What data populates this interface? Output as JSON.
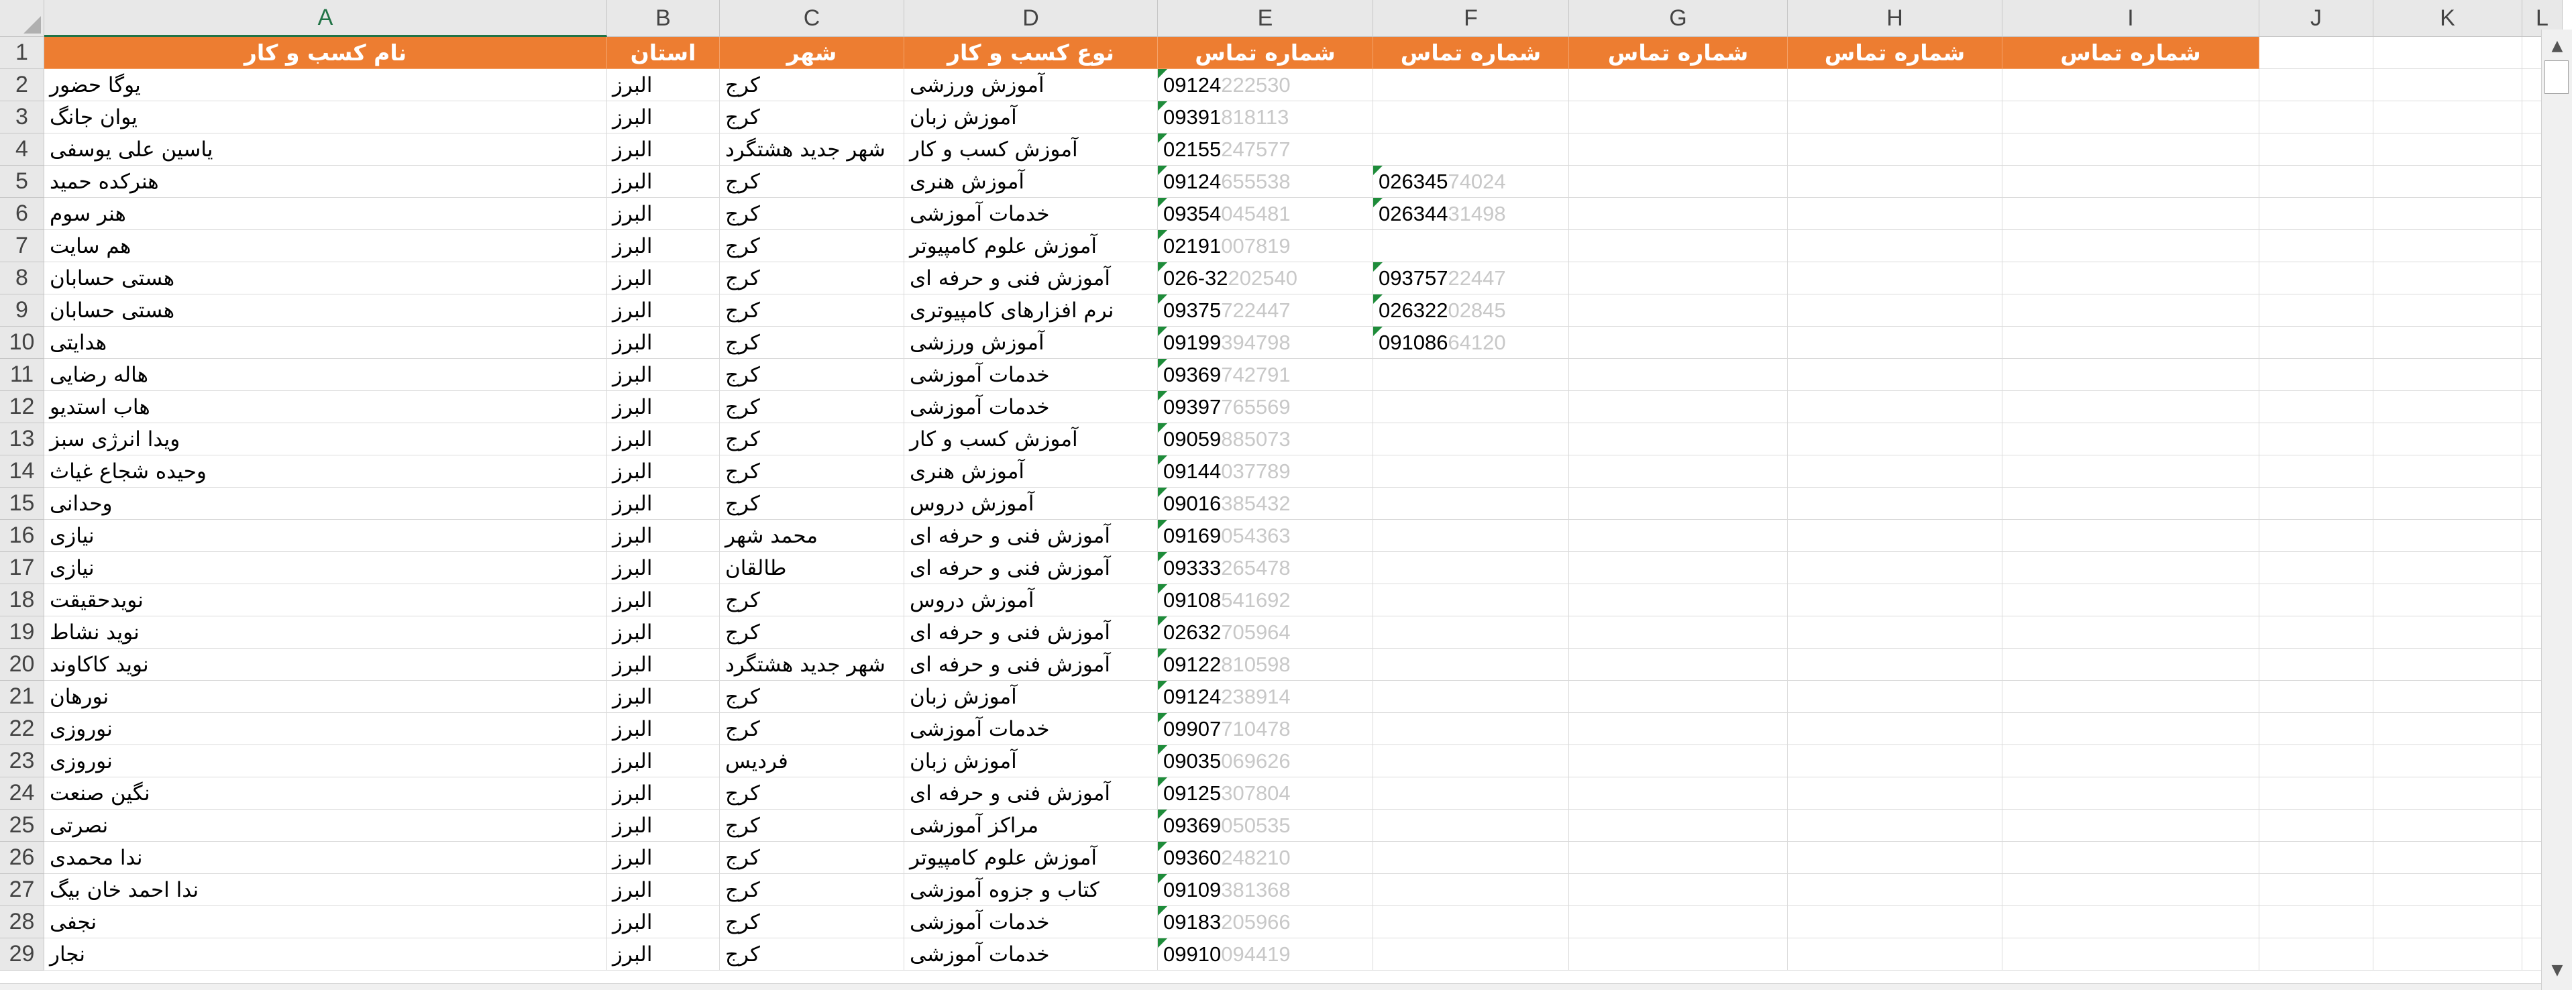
{
  "columns": [
    "A",
    "B",
    "C",
    "D",
    "E",
    "F",
    "G",
    "H",
    "I",
    "J",
    "K",
    "L"
  ],
  "header_row": [
    "نام کسب و کار",
    "استان",
    "شهر",
    "نوع کسب و کار",
    "شماره تماس",
    "شماره تماس",
    "شماره تماس",
    "شماره تماس",
    "شماره تماس"
  ],
  "row_numbers": [
    "1",
    "2",
    "3",
    "4",
    "5",
    "6",
    "7",
    "8",
    "9",
    "10",
    "11",
    "12",
    "13",
    "14",
    "15",
    "16",
    "17",
    "18",
    "19",
    "20",
    "21",
    "22",
    "23",
    "24",
    "25",
    "26",
    "27",
    "28",
    "29"
  ],
  "rows": [
    {
      "name": "یوگا حضور",
      "province": "البرز",
      "city": "کرج",
      "type": "آموزش ورزشی",
      "phone1": "09124",
      "phone1_tail": "222530",
      "phone2": "",
      "phone2_tail": ""
    },
    {
      "name": "یوان جانگ",
      "province": "البرز",
      "city": "کرج",
      "type": "آموزش زبان",
      "phone1": "09391",
      "phone1_tail": "818113",
      "phone2": "",
      "phone2_tail": ""
    },
    {
      "name": "یاسین علی یوسفی",
      "province": "البرز",
      "city": "شهر جدید هشتگرد",
      "type": "آموزش کسب و کار",
      "phone1": "02155",
      "phone1_tail": "247577",
      "phone2": "",
      "phone2_tail": ""
    },
    {
      "name": "هنرکده حمید",
      "province": "البرز",
      "city": "کرج",
      "type": "آموزش هنری",
      "phone1": "09124",
      "phone1_tail": "655538",
      "phone2": "026345",
      "phone2_tail": "74024"
    },
    {
      "name": "هنر سوم",
      "province": "البرز",
      "city": "کرج",
      "type": "خدمات آموزشی",
      "phone1": "09354",
      "phone1_tail": "045481",
      "phone2": "026344",
      "phone2_tail": "31498"
    },
    {
      "name": "هم سایت",
      "province": "البرز",
      "city": "کرج",
      "type": "آموزش علوم کامپیوتر",
      "phone1": "02191",
      "phone1_tail": "007819",
      "phone2": "",
      "phone2_tail": ""
    },
    {
      "name": "هستی حسابان",
      "province": "البرز",
      "city": "کرج",
      "type": "آموزش فنی و حرفه ای",
      "phone1": "026-32",
      "phone1_tail": "202540",
      "phone2": "093757",
      "phone2_tail": "22447"
    },
    {
      "name": "هستی حسابان",
      "province": "البرز",
      "city": "کرج",
      "type": "نرم افزارهای کامپیوتری",
      "phone1": "09375",
      "phone1_tail": "722447",
      "phone2": "026322",
      "phone2_tail": "02845"
    },
    {
      "name": "هدایتی",
      "province": "البرز",
      "city": "کرج",
      "type": "آموزش ورزشی",
      "phone1": "09199",
      "phone1_tail": "394798",
      "phone2": "091086",
      "phone2_tail": "64120"
    },
    {
      "name": "هاله رضایی",
      "province": "البرز",
      "city": "کرج",
      "type": "خدمات آموزشی",
      "phone1": "09369",
      "phone1_tail": "742791",
      "phone2": "",
      "phone2_tail": ""
    },
    {
      "name": "هاب استدیو",
      "province": "البرز",
      "city": "کرج",
      "type": "خدمات آموزشی",
      "phone1": "09397",
      "phone1_tail": "765569",
      "phone2": "",
      "phone2_tail": ""
    },
    {
      "name": "ویدا انرژی سبز",
      "province": "البرز",
      "city": "کرج",
      "type": "آموزش کسب و کار",
      "phone1": "09059",
      "phone1_tail": "885073",
      "phone2": "",
      "phone2_tail": ""
    },
    {
      "name": "وحیده شجاع غیاث",
      "province": "البرز",
      "city": "کرج",
      "type": "آموزش هنری",
      "phone1": "09144",
      "phone1_tail": "037789",
      "phone2": "",
      "phone2_tail": ""
    },
    {
      "name": "وحدانی",
      "province": "البرز",
      "city": "کرج",
      "type": "آموزش دروس",
      "phone1": "09016",
      "phone1_tail": "385432",
      "phone2": "",
      "phone2_tail": ""
    },
    {
      "name": "نیازی",
      "province": "البرز",
      "city": "محمد شهر",
      "type": "آموزش فنی و حرفه ای",
      "phone1": "09169",
      "phone1_tail": "054363",
      "phone2": "",
      "phone2_tail": ""
    },
    {
      "name": "نیازی",
      "province": "البرز",
      "city": "طالقان",
      "type": "آموزش فنی و حرفه ای",
      "phone1": "09333",
      "phone1_tail": "265478",
      "phone2": "",
      "phone2_tail": ""
    },
    {
      "name": "نویدحقیقت",
      "province": "البرز",
      "city": "کرج",
      "type": "آموزش دروس",
      "phone1": "09108",
      "phone1_tail": "541692",
      "phone2": "",
      "phone2_tail": ""
    },
    {
      "name": "نوید نشاط",
      "province": "البرز",
      "city": "کرج",
      "type": "آموزش فنی و حرفه ای",
      "phone1": "02632",
      "phone1_tail": "705964",
      "phone2": "",
      "phone2_tail": ""
    },
    {
      "name": "نوید کاکاوند",
      "province": "البرز",
      "city": "شهر جدید هشتگرد",
      "type": "آموزش فنی و حرفه ای",
      "phone1": "09122",
      "phone1_tail": "810598",
      "phone2": "",
      "phone2_tail": ""
    },
    {
      "name": "نورهان",
      "province": "البرز",
      "city": "کرج",
      "type": "آموزش زبان",
      "phone1": "09124",
      "phone1_tail": "238914",
      "phone2": "",
      "phone2_tail": ""
    },
    {
      "name": "نوروزی",
      "province": "البرز",
      "city": "کرج",
      "type": "خدمات آموزشی",
      "phone1": "09907",
      "phone1_tail": "710478",
      "phone2": "",
      "phone2_tail": ""
    },
    {
      "name": "نوروزی",
      "province": "البرز",
      "city": "فردیس",
      "type": "آموزش زبان",
      "phone1": "09035",
      "phone1_tail": "069626",
      "phone2": "",
      "phone2_tail": ""
    },
    {
      "name": "نگین صنعت",
      "province": "البرز",
      "city": "کرج",
      "type": "آموزش فنی و حرفه ای",
      "phone1": "09125",
      "phone1_tail": "307804",
      "phone2": "",
      "phone2_tail": ""
    },
    {
      "name": "نصرتی",
      "province": "البرز",
      "city": "کرج",
      "type": "مراکز آموزشی",
      "phone1": "09369",
      "phone1_tail": "050535",
      "phone2": "",
      "phone2_tail": ""
    },
    {
      "name": "ندا محمدی",
      "province": "البرز",
      "city": "کرج",
      "type": "آموزش علوم کامپیوتر",
      "phone1": "09360",
      "phone1_tail": "248210",
      "phone2": "",
      "phone2_tail": ""
    },
    {
      "name": "ندا احمد خان بیگ",
      "province": "البرز",
      "city": "کرج",
      "type": "کتاب و جزوه آموزشی",
      "phone1": "09109",
      "phone1_tail": "381368",
      "phone2": "",
      "phone2_tail": ""
    },
    {
      "name": "نجفی",
      "province": "البرز",
      "city": "کرج",
      "type": "خدمات آموزشی",
      "phone1": "09183",
      "phone1_tail": "205966",
      "phone2": "",
      "phone2_tail": ""
    },
    {
      "name": "نجار",
      "province": "البرز",
      "city": "کرج",
      "type": "خدمات آموزشی",
      "phone1": "09910",
      "phone1_tail": "094419",
      "phone2": "",
      "phone2_tail": ""
    }
  ],
  "colors": {
    "header_fill": "#ed7d31",
    "header_text": "#ffffff",
    "error_triangle": "#1e8c3a"
  },
  "icons": {
    "scroll_up": "scroll-up-arrow-icon",
    "scroll_down": "scroll-down-arrow-icon"
  }
}
